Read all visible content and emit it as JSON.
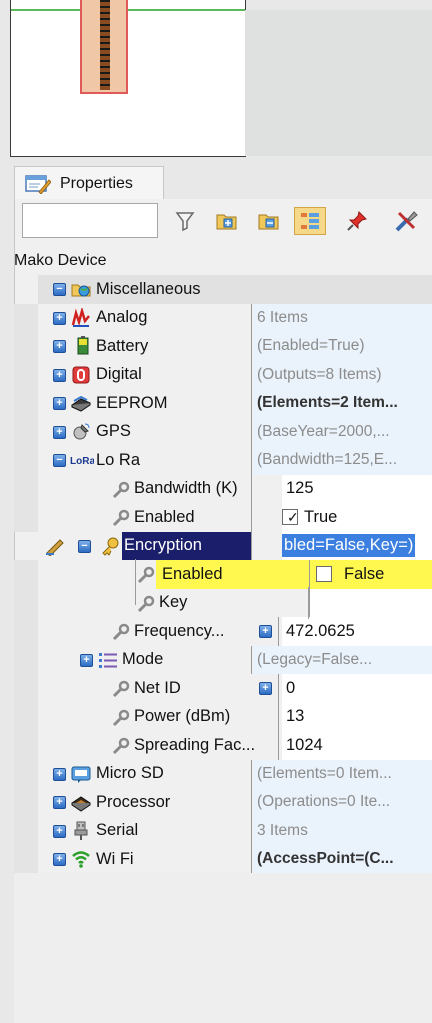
{
  "tab": {
    "label": "Properties"
  },
  "search": {
    "value": "",
    "placeholder": ""
  },
  "root": {
    "label": "Mako Device"
  },
  "rows": [
    {
      "name": "Miscellaneous",
      "value": "",
      "icon": "folder-globe-icon"
    },
    {
      "name": "Analog",
      "value": "6 Items",
      "icon": "analog-icon"
    },
    {
      "name": "Battery",
      "value": "(Enabled=True)",
      "icon": "battery-icon"
    },
    {
      "name": "Digital",
      "value": "(Outputs=8 Items)",
      "icon": "digital-icon"
    },
    {
      "name": "EEPROM",
      "value": "(Elements=2 Item...",
      "icon": "chip-icon"
    },
    {
      "name": "GPS",
      "value": "(BaseYear=2000,...",
      "icon": "satellite-icon"
    },
    {
      "name": "Lo Ra",
      "value": "(Bandwidth=125,E...",
      "icon": "lora-icon",
      "badge": "LoRa"
    },
    {
      "name": "Bandwidth (K)",
      "value": "125",
      "icon": "wrench-icon"
    },
    {
      "name": "Enabled",
      "value": "True",
      "icon": "wrench-icon"
    },
    {
      "name": "Encryption",
      "value": "bled=False,Key=)",
      "icon": "key-icon"
    },
    {
      "name": "Enabled",
      "value": "False",
      "icon": "wrench-icon"
    },
    {
      "name": "Key",
      "value": "",
      "icon": "wrench-icon"
    },
    {
      "name": "Frequency...",
      "value": "472.0625",
      "icon": "wrench-icon"
    },
    {
      "name": "Mode",
      "value": "(Legacy=False...",
      "icon": "list-icon"
    },
    {
      "name": "Net ID",
      "value": "0",
      "icon": "wrench-icon"
    },
    {
      "name": "Power (dBm)",
      "value": "13",
      "icon": "wrench-icon"
    },
    {
      "name": "Spreading Fac...",
      "value": "1024",
      "icon": "wrench-icon"
    },
    {
      "name": "Micro SD",
      "value": "(Elements=0 Item...",
      "icon": "sdcard-icon"
    },
    {
      "name": "Processor",
      "value": "(Operations=0 Ite...",
      "icon": "processor-icon"
    },
    {
      "name": "Serial",
      "value": "3 Items",
      "icon": "serial-icon"
    },
    {
      "name": "Wi Fi",
      "value": "(AccessPoint=(C...",
      "icon": "wifi-icon"
    }
  ],
  "colors": {
    "selection": "#1b1f6b",
    "highlight": "#fff94f",
    "value_bg": "#eaf2fb"
  }
}
